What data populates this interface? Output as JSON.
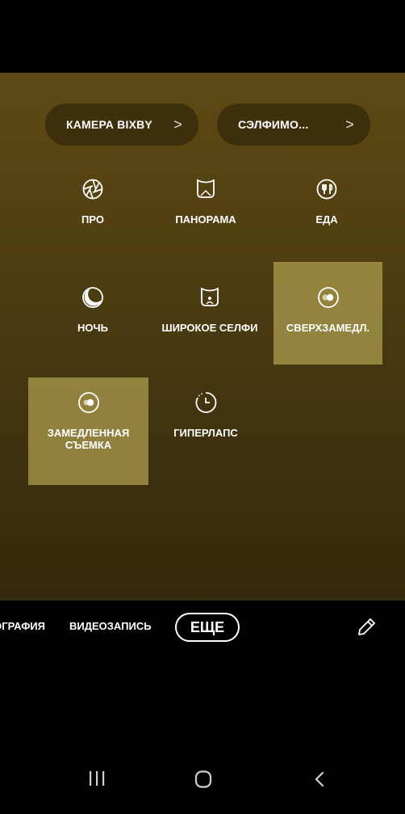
{
  "shortcuts": {
    "bixby_label": "КАМЕРА BIXBY",
    "selfie_label": "СЭЛФИМО...",
    "chevron": ">"
  },
  "modes": {
    "pro": "ПРО",
    "panorama": "ПАНОРАМА",
    "food": "ЕДА",
    "night": "НОЧЬ",
    "wide_selfie": "ШИРОКОЕ СЕЛФИ",
    "super_slow": "СВЕРХЗАМЕДЛ.",
    "slow_motion": "ЗАМЕДЛЕННАЯ СЪЕМКА",
    "hyperlapse": "ГИПЕРЛАПС"
  },
  "mode_bar": {
    "photo_label": "ФОТОГРАФИЯ",
    "video_label": "ВИДЕОЗАПИСЬ",
    "more_label": "ЕЩЕ"
  },
  "icons": {
    "pro": "aperture-icon",
    "panorama": "panorama-icon",
    "food": "fork-knife-icon",
    "night": "moon-icon",
    "wide_selfie": "wide-selfie-icon",
    "super_slow": "super-slow-icon",
    "slow_motion": "slow-motion-icon",
    "hyperlapse": "hyperlapse-icon",
    "edit": "pencil-icon"
  },
  "colors": {
    "highlight": "#b0a050",
    "viewfinder": "#4f3e11"
  }
}
